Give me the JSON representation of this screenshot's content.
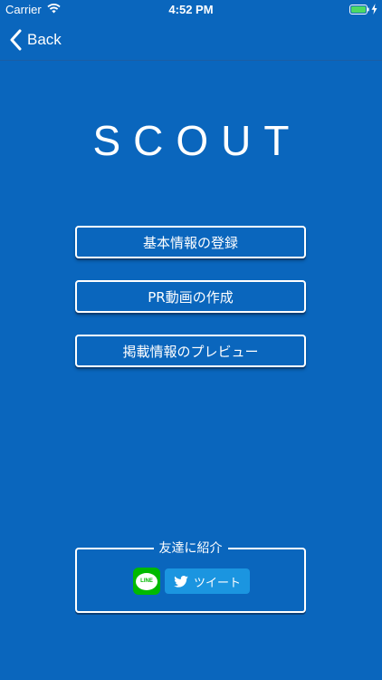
{
  "status_bar": {
    "carrier": "Carrier",
    "time": "4:52 PM"
  },
  "nav": {
    "back_label": "Back"
  },
  "logo": {
    "text": "SCOUT"
  },
  "menu": {
    "items": [
      {
        "label": "基本情報の登録"
      },
      {
        "label": "PR動画の作成"
      },
      {
        "label": "掲載情報のプレビュー"
      }
    ]
  },
  "share": {
    "title": "友達に紹介",
    "line_label": "LINE",
    "tweet_label": "ツイート"
  },
  "colors": {
    "background": "#0a66bd",
    "line_green": "#00b900",
    "twitter_blue": "#1b95e0",
    "battery_green": "#4cd964"
  }
}
